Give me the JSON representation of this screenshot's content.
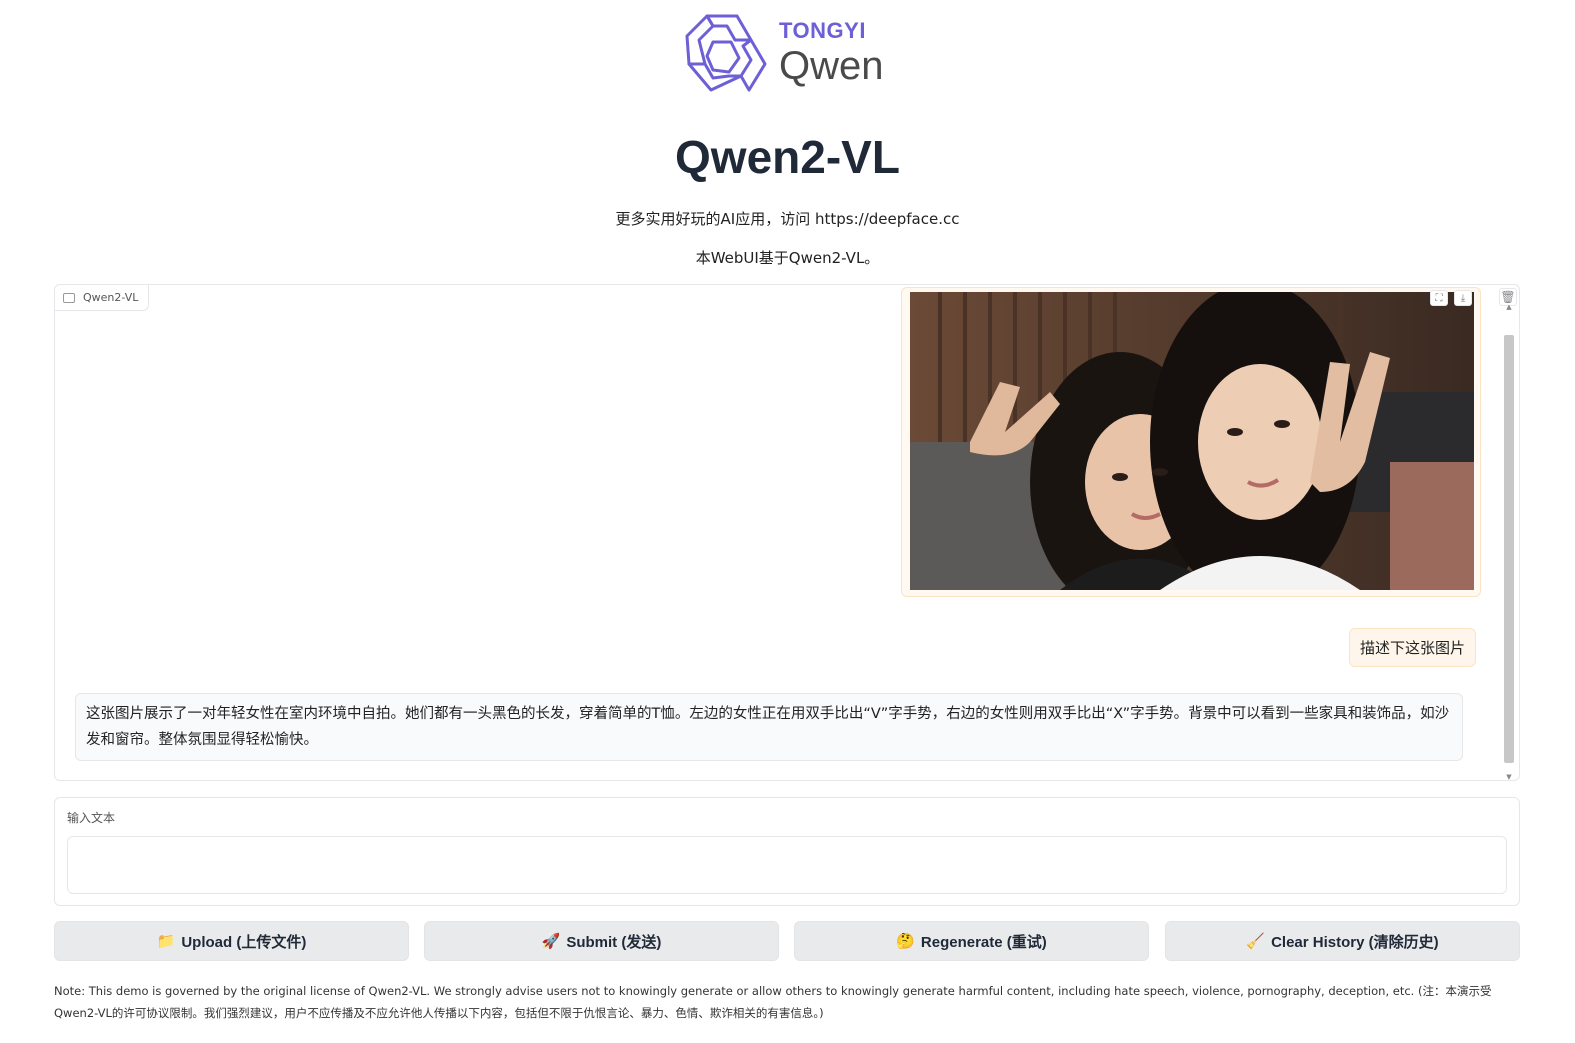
{
  "logo": {
    "brand_top": "TONGYI",
    "brand_bottom": "Qwen",
    "brand_color": "#6d5fd6"
  },
  "header": {
    "title": "Qwen2-VL",
    "subtitle_link_line": "更多实用好玩的AI应用，访问 https://deepface.cc",
    "subtitle_info_line": "本WebUI基于Qwen2-VL。"
  },
  "chatbot": {
    "label": "Qwen2-VL",
    "image_message": {
      "description": "selfie photo of two women making V hand gestures"
    },
    "user_message": "描述下这张图片",
    "bot_message": "这张图片展示了一对年轻女性在室内环境中自拍。她们都有一头黑色的长发，穿着简单的T恤。左边的女性正在用双手比出“V”字手势，右边的女性则用双手比出“X”字手势。背景中可以看到一些家具和装饰品，如沙发和窗帘。整体氛围显得轻松愉快。"
  },
  "input": {
    "label": "输入文本",
    "value": "",
    "placeholder": ""
  },
  "buttons": {
    "upload": {
      "icon": "📁",
      "label": "Upload (上传文件)"
    },
    "submit": {
      "icon": "🚀",
      "label": "Submit (发送)"
    },
    "regenerate": {
      "icon": "🤔",
      "label": "Regenerate (重试)"
    },
    "clear": {
      "icon": "🧹",
      "label": "Clear History (清除历史)"
    }
  },
  "note": "Note: This demo is governed by the original license of Qwen2-VL. We strongly advise users not to knowingly generate or allow others to knowingly generate harmful content, including hate speech, violence, pornography, deception, etc. (注：本演示受Qwen2-VL的许可协议限制。我们强烈建议，用户不应传播及不应允许他人传播以下内容，包括但不限于仇恨言论、暴力、色情、欺诈相关的有害信息。)"
}
